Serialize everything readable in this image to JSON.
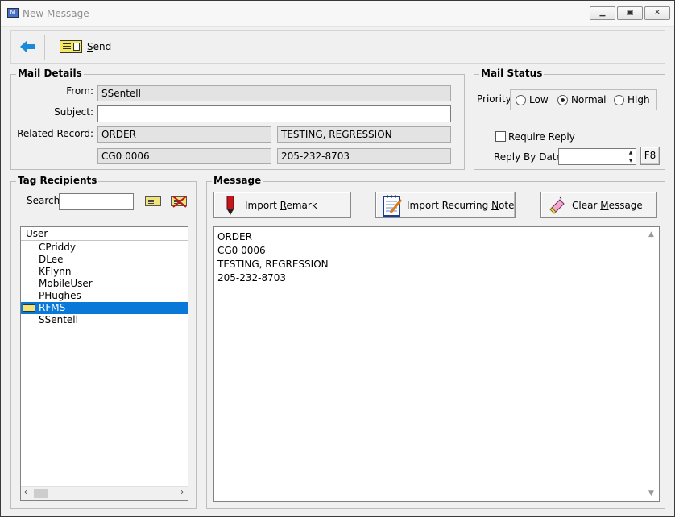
{
  "window": {
    "title": "New Message",
    "app_icon_text": "M"
  },
  "toolbar": {
    "send_label_first": "S",
    "send_label_rest": "end"
  },
  "mail_details": {
    "group_label": "Mail Details",
    "from_label": "From:",
    "from_value": "SSentell",
    "subject_label": "Subject:",
    "subject_value": "",
    "related_record_label": "Related Record:",
    "record_type": "ORDER",
    "record_name": "TESTING, REGRESSION",
    "record_id": "CG0 0006",
    "record_phone": "205-232-8703"
  },
  "mail_status": {
    "group_label": "Mail Status",
    "priority_label": "Priority",
    "priority_options": [
      "Low",
      "Normal",
      "High"
    ],
    "priority_selected": "Normal",
    "require_reply_label": "Require Reply",
    "require_reply_checked": false,
    "reply_by_date_label": "Reply By Date",
    "reply_by_date_value": "",
    "f8_label": "F8"
  },
  "tag_recipients": {
    "group_label": "Tag Recipients",
    "search_label": "Search",
    "search_value": "",
    "column_header": "User",
    "users": [
      {
        "name": "CPriddy",
        "selected": false
      },
      {
        "name": "DLee",
        "selected": false
      },
      {
        "name": "KFlynn",
        "selected": false
      },
      {
        "name": "MobileUser",
        "selected": false
      },
      {
        "name": "PHughes",
        "selected": false
      },
      {
        "name": "RFMS",
        "selected": true
      },
      {
        "name": "SSentell",
        "selected": false
      }
    ]
  },
  "message": {
    "group_label": "Message",
    "import_remark_pre": "Import ",
    "import_remark_ul": "R",
    "import_remark_post": "emark",
    "import_note_pre": "Import Recurring ",
    "import_note_ul": "N",
    "import_note_post": "ote",
    "clear_pre": "Clear ",
    "clear_ul": "M",
    "clear_post": "essage",
    "body": "ORDER\nCG0 0006\nTESTING, REGRESSION\n205-232-8703"
  }
}
